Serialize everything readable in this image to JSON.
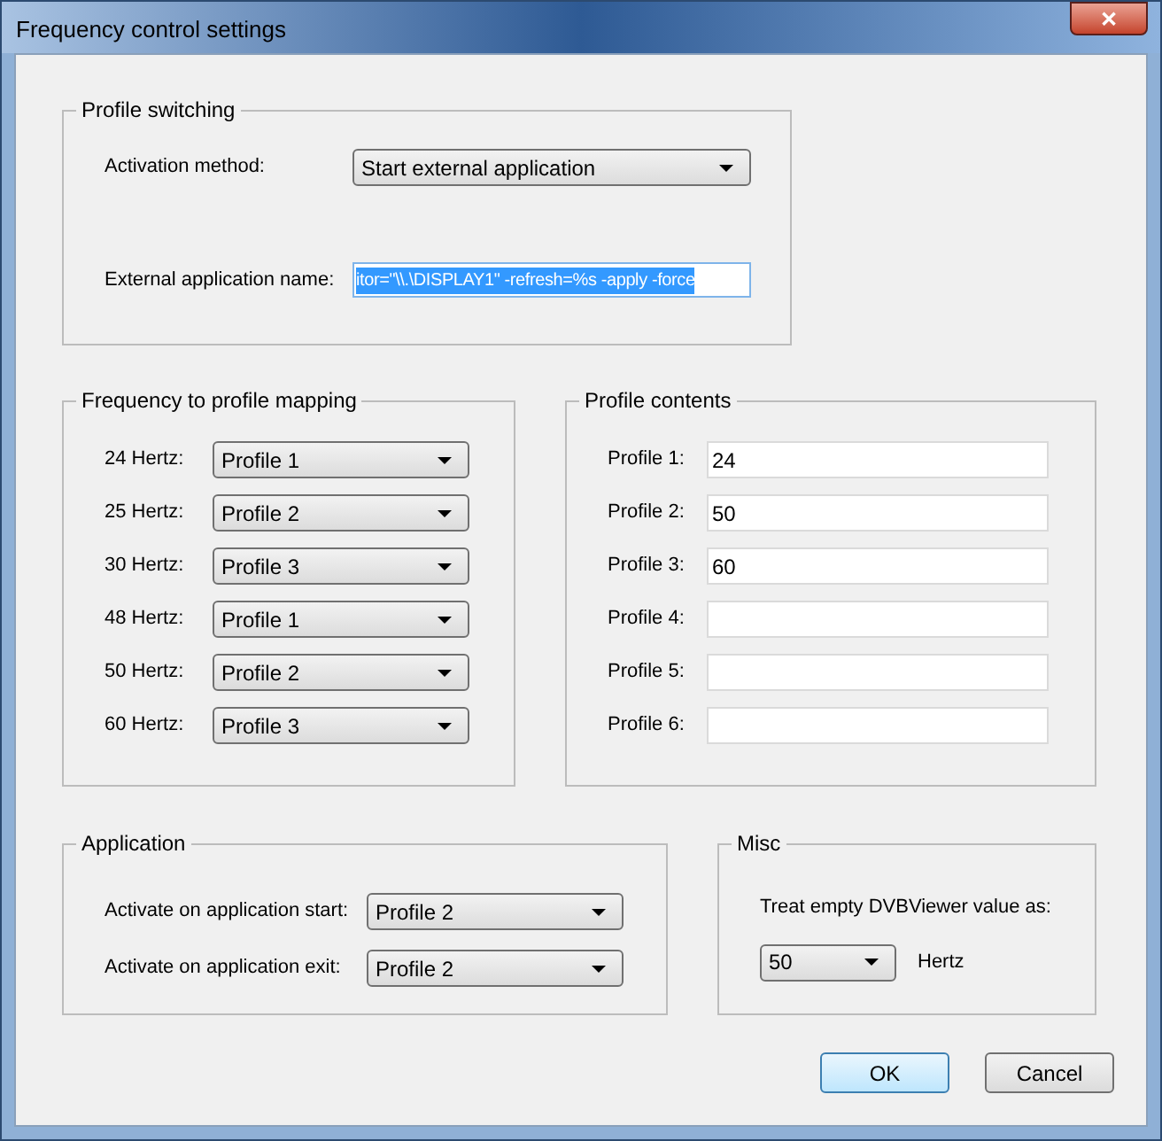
{
  "window": {
    "title": "Frequency control settings",
    "close_label": "✕"
  },
  "profile_switching": {
    "title": "Profile switching",
    "activation_label": "Activation method:",
    "activation_value": "Start external application",
    "app_name_label": "External application name:",
    "app_name_value": "itor=\"\\\\.\\DISPLAY1\" -refresh=%s -apply -force",
    "app_name_selected": true
  },
  "mapping": {
    "title": "Frequency to profile mapping",
    "rows": [
      {
        "label": "24 Hertz:",
        "value": "Profile 1"
      },
      {
        "label": "25 Hertz:",
        "value": "Profile 2"
      },
      {
        "label": "30 Hertz:",
        "value": "Profile 3"
      },
      {
        "label": "48 Hertz:",
        "value": "Profile 1"
      },
      {
        "label": "50 Hertz:",
        "value": "Profile 2"
      },
      {
        "label": "60 Hertz:",
        "value": "Profile 3"
      }
    ]
  },
  "profile_contents": {
    "title": "Profile contents",
    "rows": [
      {
        "label": "Profile 1:",
        "value": "24"
      },
      {
        "label": "Profile 2:",
        "value": "50"
      },
      {
        "label": "Profile 3:",
        "value": "60"
      },
      {
        "label": "Profile 4:"
      },
      {
        "label": "Profile 5:"
      },
      {
        "label": "Profile 6:"
      }
    ]
  },
  "application": {
    "title": "Application",
    "rows": [
      {
        "label": "Activate on application start:",
        "value": "Profile 2"
      },
      {
        "label": "Activate on application exit:",
        "value": "Profile 2"
      }
    ]
  },
  "misc": {
    "title": "Misc",
    "label": "Treat empty DVBViewer value as:",
    "value": "50",
    "unit": "Hertz"
  },
  "buttons": [
    {
      "label": "OK",
      "default": true
    },
    {
      "label": "Cancel",
      "default": false
    }
  ]
}
